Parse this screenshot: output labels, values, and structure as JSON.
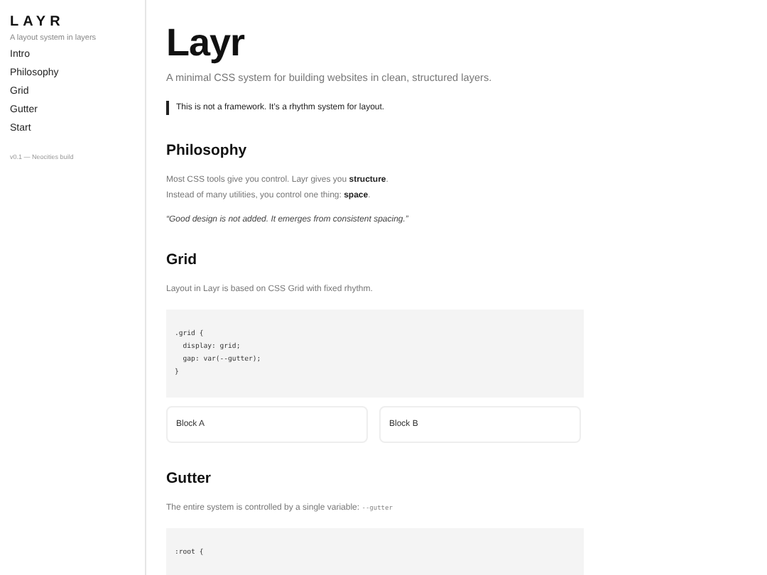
{
  "sidebar": {
    "logo": "LAYR",
    "tagline": "A layout system in layers",
    "items": [
      {
        "label": "Intro"
      },
      {
        "label": "Philosophy"
      },
      {
        "label": "Grid"
      },
      {
        "label": "Gutter"
      },
      {
        "label": "Start"
      }
    ],
    "version": "v0.1 — Neocities build"
  },
  "main": {
    "title": "Layr",
    "subtitle": "A minimal CSS system for building websites in clean, structured layers.",
    "callout": "This is not a framework. It’s a rhythm system for layout.",
    "sections": [
      {
        "heading": "Philosophy",
        "content": [
          {
            "kind": "text",
            "lines": [
              "Most CSS tools give you control. Layr gives you **structure**.",
              "Instead of many utilities, you control one thing: **space**."
            ]
          },
          {
            "kind": "quote",
            "text": "“Good design is not added. It emerges from consistent spacing.”"
          }
        ]
      },
      {
        "heading": "Grid",
        "content": [
          {
            "kind": "text",
            "lines": [
              "Layout in Layr is based on CSS Grid with fixed rhythm."
            ]
          },
          {
            "kind": "code",
            "lines": [
              ".grid {",
              "  display: grid;",
              "  gap: var(--gutter);",
              "}"
            ]
          },
          {
            "kind": "blocks",
            "items": [
              "Block A",
              "Block B"
            ]
          }
        ]
      },
      {
        "heading": "Gutter",
        "content": [
          {
            "kind": "text_code",
            "text": "The entire system is controlled by a single variable:",
            "code": "--gutter"
          },
          {
            "kind": "code",
            "lines": [
              ":root {"
            ]
          }
        ]
      }
    ]
  }
}
